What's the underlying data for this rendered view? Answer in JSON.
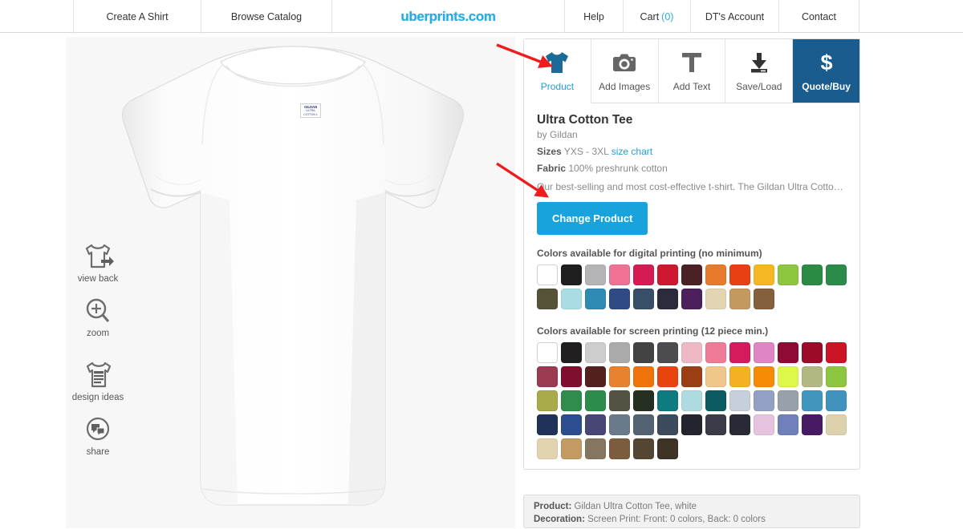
{
  "nav": {
    "items": [
      {
        "label": "Create A Shirt"
      },
      {
        "label": "Browse Catalog"
      }
    ],
    "logo": "uberprints.com",
    "right_items": [
      {
        "label": "Help"
      },
      {
        "label": "Cart",
        "count": "(0)"
      },
      {
        "label": "DT's Account"
      },
      {
        "label": "Contact"
      }
    ]
  },
  "tools": [
    {
      "label": "view back",
      "icon": "shirt-back-icon"
    },
    {
      "label": "zoom",
      "icon": "magnifier-plus-icon"
    },
    {
      "label": "design ideas",
      "icon": "shirt-lines-icon"
    },
    {
      "label": "share",
      "icon": "share-chat-icon"
    }
  ],
  "shirt": {
    "collar_brand": "GILDAN",
    "collar_sub": "ULTRA COTTON",
    "collar_size": "L"
  },
  "tabs": [
    {
      "label": "Product",
      "icon": "tshirt-icon",
      "state": "active"
    },
    {
      "label": "Add Images",
      "icon": "camera-icon",
      "state": "normal"
    },
    {
      "label": "Add Text",
      "icon": "text-t-icon",
      "state": "normal"
    },
    {
      "label": "Save/Load",
      "icon": "download-icon",
      "state": "normal"
    },
    {
      "label": "Quote/Buy",
      "icon": "dollar-icon",
      "state": "highlighted"
    }
  ],
  "product": {
    "title": "Ultra Cotton Tee",
    "brand": "by Gildan",
    "sizes_key": "Sizes",
    "sizes_value": "YXS - 3XL",
    "size_chart_link": "size chart",
    "fabric_key": "Fabric",
    "fabric_value": "100% preshrunk cotton",
    "description": "Our best-selling and most cost-effective t-shirt. The Gildan Ultra Cotton Tee i...",
    "change_button": "Change Product"
  },
  "digital_colors": {
    "title": "Colors available for digital printing (no minimum)",
    "swatches": [
      "#ffffff",
      "#201f1f",
      "#b4b4b6",
      "#ef7193",
      "#d61a53",
      "#cf182f",
      "#4c2123",
      "#e87a2c",
      "#e83f13",
      "#f5b724",
      "#8dc63f",
      "#2b8b45",
      "#2b8b4a",
      "#555238",
      "#aadde3",
      "#2e8cb4",
      "#2f4a85",
      "#384f68",
      "#2a2b3c",
      "#4d1f5c",
      "#e3d5b4",
      "#c4995f",
      "#84603d"
    ]
  },
  "screen_colors": {
    "title": "Colors available for screen printing (12 piece min.)",
    "swatches": [
      "#ffffff",
      "#211f1f",
      "#cdcdcd",
      "#aaaaaa",
      "#434343",
      "#4c4c50",
      "#eeb8c4",
      "#ef7a96",
      "#d61a5e",
      "#e085c3",
      "#900b33",
      "#9c0b29",
      "#cc1427",
      "#9b3a51",
      "#800e2e",
      "#53201f",
      "#e8822e",
      "#ef7309",
      "#e94410",
      "#9c3e14",
      "#f0c68b",
      "#f4b223",
      "#f78b06",
      "#ddf84a",
      "#b3b883",
      "#8cc63e",
      "#a9ab4a",
      "#2f8c4c",
      "#2d8c4c",
      "#545242",
      "#253022",
      "#0d7b7f",
      "#aedbe0",
      "#0c5b61",
      "#c6cfdc",
      "#93a0c4",
      "#98a0ab",
      "#4195bf",
      "#3f93bd",
      "#21325a",
      "#2c4e8e",
      "#474674",
      "#6b7a8b",
      "#536373",
      "#3b4a5d",
      "#22242f",
      "#3b3c4a",
      "#292a38",
      "#e6c3de",
      "#6f80bc",
      "#481a63",
      "#ddd1ae",
      "#e2d3b1",
      "#c49a63",
      "#857660",
      "#7c5c3e",
      "#554633",
      "#3f3326"
    ]
  },
  "status": {
    "product_key": "Product:",
    "product_value": "Gildan Ultra Cotton Tee, white",
    "decoration_key": "Decoration:",
    "decoration_value": "Screen Print: Front: 0 colors, Back: 0 colors"
  }
}
